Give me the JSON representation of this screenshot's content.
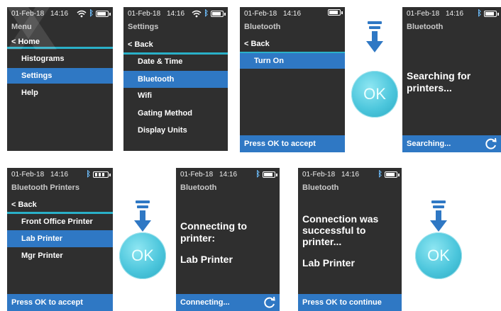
{
  "colors": {
    "accent": "#2f78c4",
    "separator": "#2ab0c8",
    "screen_bg": "#2f2f2f",
    "ok_button": "#4cc6dc"
  },
  "screens": {
    "menu": {
      "date": "01-Feb-18",
      "time": "14:16",
      "title": "Menu",
      "items": [
        "< Home",
        "Histograms",
        "Settings",
        "Help"
      ]
    },
    "settings": {
      "date": "01-Feb-18",
      "time": "14:16",
      "title": "Settings",
      "items": [
        "< Back",
        "Date & Time",
        "Bluetooth",
        "Wifi",
        "Gating Method",
        "Display Units"
      ]
    },
    "bluetooth": {
      "date": "01-Feb-18",
      "time": "14:16",
      "title": "Bluetooth",
      "items": [
        "< Back",
        "Turn On"
      ],
      "footer": "Press OK to accept"
    },
    "searching": {
      "date": "01-Feb-18",
      "time": "14:16",
      "title": "Bluetooth",
      "message_line1": "Searching for",
      "message_line2": "printers...",
      "footer": "Searching..."
    },
    "printers": {
      "date": "01-Feb-18",
      "time": "14:16",
      "title": "Bluetooth Printers",
      "items": [
        "< Back",
        "Front Office Printer",
        "Lab Printer",
        "Mgr Printer"
      ],
      "footer": "Press OK to accept"
    },
    "connecting": {
      "date": "01-Feb-18",
      "time": "14:16",
      "title": "Bluetooth",
      "message_line1": "Connecting to",
      "message_line2": "printer:",
      "printer": "Lab Printer",
      "footer": "Connecting..."
    },
    "connected": {
      "date": "01-Feb-18",
      "time": "14:16",
      "title": "Bluetooth",
      "message_line1": "Connection was",
      "message_line2": "successful to",
      "message_line3": "printer...",
      "printer": "Lab Printer",
      "footer": "Press OK to continue"
    }
  },
  "ok_label": "OK",
  "icons": {
    "bluetooth": "bluetooth-icon",
    "battery": "battery-icon",
    "wifi": "wifi-icon",
    "refresh": "refresh-icon",
    "arrow": "down-arrow-icon"
  }
}
